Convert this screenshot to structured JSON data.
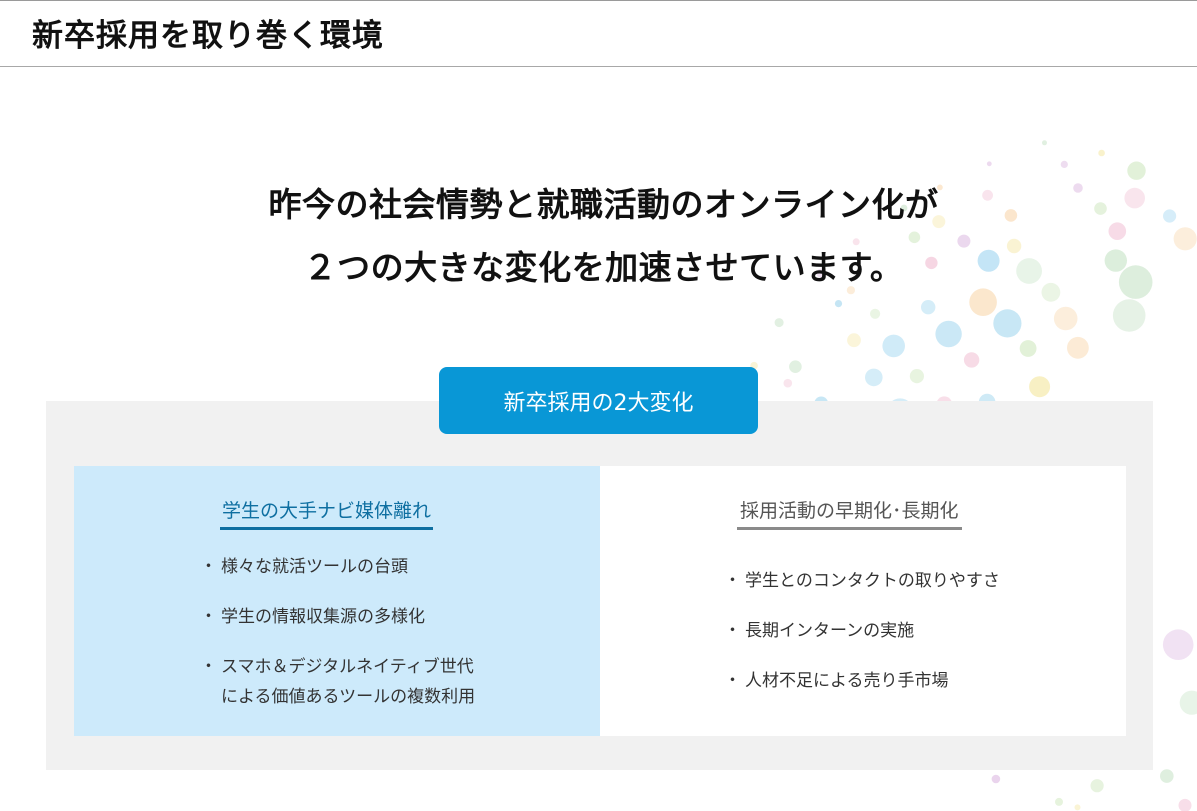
{
  "page": {
    "title": "新卒採用を取り巻く環境"
  },
  "headline": {
    "line1": "昨今の社会情勢と就職活動のオンライン化が",
    "line2": "２つの大きな変化を加速させています。"
  },
  "panel": {
    "badge_label": "新卒採用の2大変化",
    "left": {
      "title": "学生の大手ナビ媒体離れ",
      "items": [
        [
          "様々な就活ツールの台頭"
        ],
        [
          "学生の情報収集源の多様化"
        ],
        [
          "スマホ＆デジタルネイティブ世代",
          "による価値あるツールの複数利用"
        ]
      ]
    },
    "right": {
      "title": "採用活動の早期化･長期化",
      "items": [
        [
          "学生とのコンタクトの取りやすさ"
        ],
        [
          "長期インターンの実施"
        ],
        [
          "人材不足による売り手市場"
        ]
      ]
    }
  },
  "colors": {
    "accent_blue": "#0997d6",
    "left_column_bg": "#cdeafb",
    "left_title_color": "#0e6fa1",
    "panel_bg": "#f1f1f1"
  },
  "decoration": {
    "dot_palette": [
      "#b7dff2",
      "#d9ecd9",
      "#f8efc2",
      "#f6d6e3",
      "#bfe3f5",
      "#e0f0d6",
      "#fbe4c8",
      "#e9d3ec"
    ]
  }
}
